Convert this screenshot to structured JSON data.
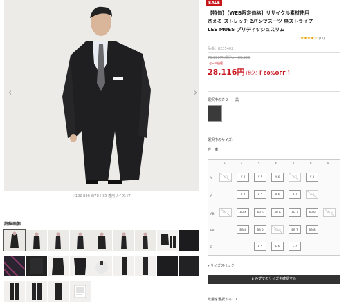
{
  "sale_badge": "SALE",
  "product": {
    "title_line1": "【特価】【WEB限定価格】リサイクル素材使用",
    "title_line2": "洗える ストレッチ 2パンツスーツ 黒ストライプ",
    "title_line3": "LES MUES プリティッシュスリム",
    "rating": "★★★★☆",
    "review_count": "(12)",
    "product_id": "品番：8235402",
    "old_price": "79,990円 (税込) ~89,990",
    "sale_tag": "セール価格",
    "price": "28,116円",
    "tax": "(税込)",
    "discount": "[ 60%OFF ]"
  },
  "image": {
    "caption": "H182 B96 W78 H95 着用サイズ:Y7",
    "prev_arrow": "‹",
    "next_arrow": "›"
  },
  "detail": {
    "title": "詳細画像"
  },
  "color": {
    "label": "選択中のカラー：黒"
  },
  "size": {
    "label": "選択中のサイズ：",
    "stock_label": "在　庫：",
    "columns": [
      "3",
      "4",
      "5",
      "6",
      "7",
      "8",
      "9"
    ],
    "rows": [
      "Y",
      "A",
      "AB",
      "BB",
      "E"
    ],
    "cells": [
      {
        "label": "Y 3",
        "na": true
      },
      {
        "label": "Y 4",
        "na": false
      },
      {
        "label": "Y 5",
        "na": false
      },
      {
        "label": "Y 6",
        "na": false
      },
      {
        "label": "Y 7",
        "na": true
      },
      {
        "label": "Y 8",
        "na": false
      },
      {
        "label": "A 4",
        "na": false
      },
      {
        "label": "A 5",
        "na": false
      },
      {
        "label": "A 6",
        "na": false
      },
      {
        "label": "A 7",
        "na": false
      },
      {
        "label": "A 8",
        "na": true
      },
      {
        "label": "AB 3",
        "na": true
      },
      {
        "label": "AB 4",
        "na": false
      },
      {
        "label": "AB 5",
        "na": false
      },
      {
        "label": "AB 6",
        "na": false
      },
      {
        "label": "AB 7",
        "na": false
      },
      {
        "label": "AB 8",
        "na": false
      },
      {
        "label": "AB 9",
        "na": true
      },
      {
        "label": "BB 4",
        "na": false
      },
      {
        "label": "BB 5",
        "na": false
      },
      {
        "label": "BB 6",
        "na": true
      },
      {
        "label": "BB 7",
        "na": false
      },
      {
        "label": "BB 8",
        "na": false
      },
      {
        "label": "E 5",
        "na": false
      },
      {
        "label": "E 6",
        "na": false
      },
      {
        "label": "E 7",
        "na": false
      }
    ]
  },
  "spec_link": "サイズスペック",
  "cart_button": "みずすのサイズを確認する",
  "quantity_label": "数量を選択する：1",
  "colors": {
    "accent": "#c8161d",
    "button": "#333333"
  }
}
